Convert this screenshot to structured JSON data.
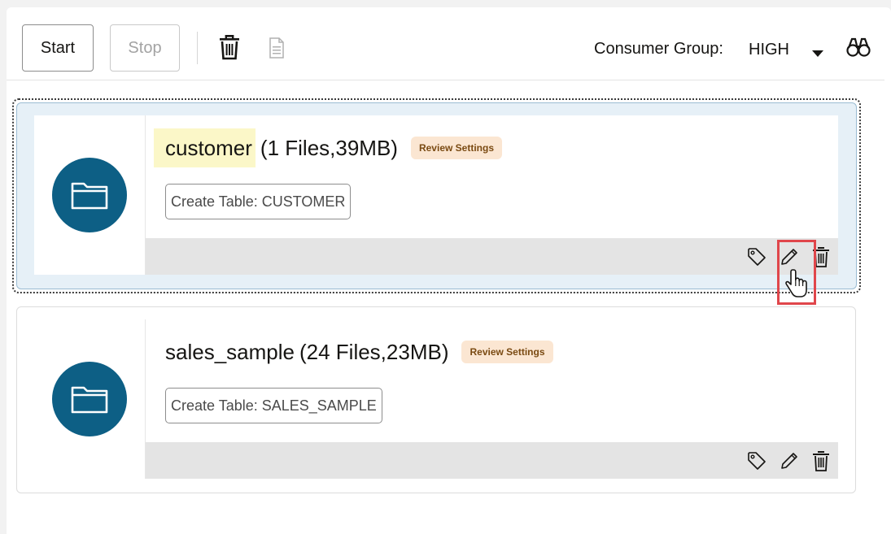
{
  "toolbar": {
    "start_label": "Start",
    "stop_label": "Stop",
    "consumer_group_label": "Consumer Group:",
    "consumer_group_value": "HIGH"
  },
  "cards": [
    {
      "name": "customer",
      "meta": "(1 Files,39MB)",
      "badge": "Review Settings",
      "action": "Create Table: CUSTOMER"
    },
    {
      "name": "sales_sample",
      "meta": "(24 Files,23MB)",
      "badge": "Review Settings",
      "action": "Create Table: SALES_SAMPLE"
    }
  ],
  "colors": {
    "folder_circle": "#0d5f85",
    "badge_bg": "#fbe6d2",
    "badge_text": "#7a4a12",
    "selected_card_bg": "#e6f0f7",
    "highlight_box": "#e0464b",
    "name_highlight": "#fbf7c8"
  },
  "icons": {
    "toolbar": [
      "trash-icon",
      "document-icon",
      "chevron-down-icon",
      "binoculars-icon"
    ],
    "card_actions": [
      "tag-icon",
      "pencil-icon",
      "trash-icon"
    ],
    "card_icon": "folder-icon",
    "cursor": "hand-pointer-icon"
  }
}
